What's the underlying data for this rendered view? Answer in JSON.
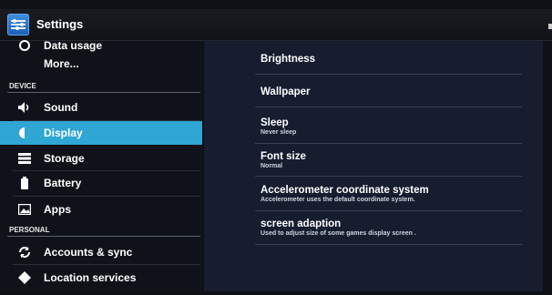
{
  "app": {
    "title": "Settings"
  },
  "colors": {
    "accent": "#2fa6d4",
    "panel": "#161d2f",
    "sidebar": "#0f1218"
  },
  "sidebar": {
    "items": [
      {
        "label": "Data usage",
        "icon": "data-usage-icon"
      },
      {
        "label": "More...",
        "icon": ""
      },
      {
        "label": "Sound",
        "icon": "speaker-icon"
      },
      {
        "label": "Display",
        "icon": "display-icon",
        "selected": true
      },
      {
        "label": "Storage",
        "icon": "storage-icon"
      },
      {
        "label": "Battery",
        "icon": "battery-icon"
      },
      {
        "label": "Apps",
        "icon": "apps-icon"
      },
      {
        "label": "Accounts & sync",
        "icon": "sync-icon"
      },
      {
        "label": "Location services",
        "icon": "location-icon"
      }
    ],
    "sections": {
      "device": "DEVICE",
      "personal": "PERSONAL"
    }
  },
  "display_settings": [
    {
      "title": "Brightness",
      "summary": ""
    },
    {
      "title": "Wallpaper",
      "summary": ""
    },
    {
      "title": "Sleep",
      "summary": "Never sleep"
    },
    {
      "title": "Font size",
      "summary": "Normal"
    },
    {
      "title": "Accelerometer coordinate system",
      "summary": "Accelerometer uses the default coordinate system."
    },
    {
      "title": "screen adaption",
      "summary": "Used to adjust size of some games display screen ."
    }
  ]
}
